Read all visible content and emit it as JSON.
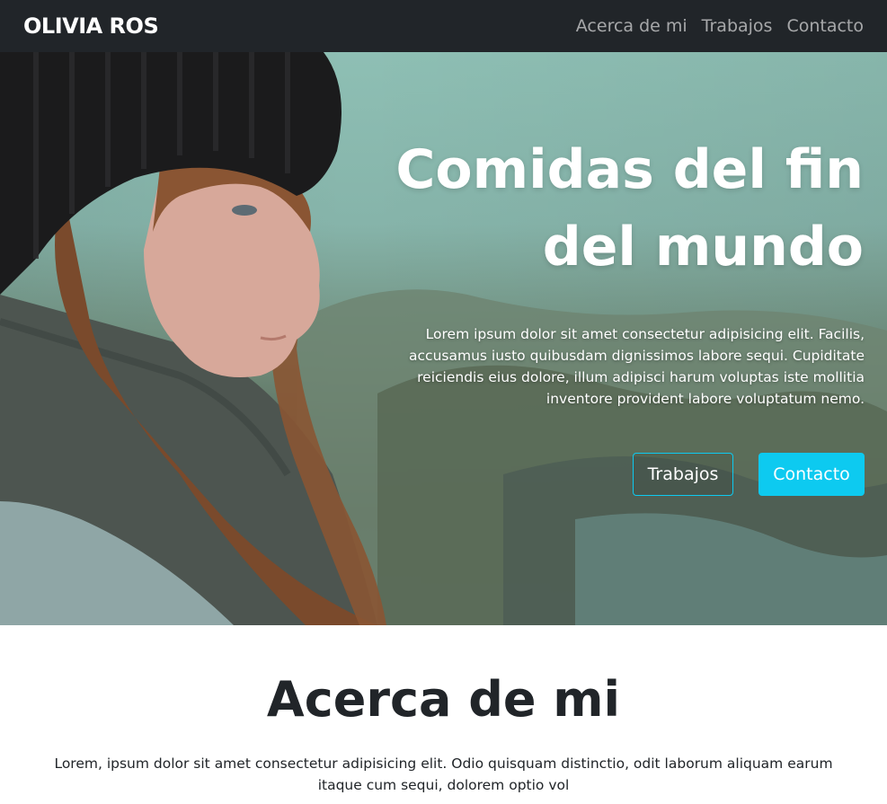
{
  "navbar": {
    "brand": "OLIVIA ROS",
    "links": [
      "Acerca de mi",
      "Trabajos",
      "Contacto"
    ]
  },
  "hero": {
    "title_line1": "Comidas del fin",
    "title_line2": "del mundo",
    "text": "Lorem ipsum dolor sit amet consectetur adipisicing elit. Facilis, accusamus iusto quibusdam dignissimos labore sequi. Cupiditate reiciendis eius dolore, illum adipisci harum voluptas iste mollitia inventore provident labore voluptatum nemo.",
    "buttons": {
      "outline_label": "Trabajos",
      "primary_label": "Contacto"
    }
  },
  "about": {
    "title": "Acerca de mi",
    "text": "Lorem, ipsum dolor sit amet consectetur adipisicing elit. Odio quisquam distinctio, odit laborum aliquam earum itaque cum sequi, dolorem optio vol"
  },
  "colors": {
    "navbar_bg": "#212529",
    "accent": "#0dcaf0",
    "text_dark": "#212529"
  }
}
